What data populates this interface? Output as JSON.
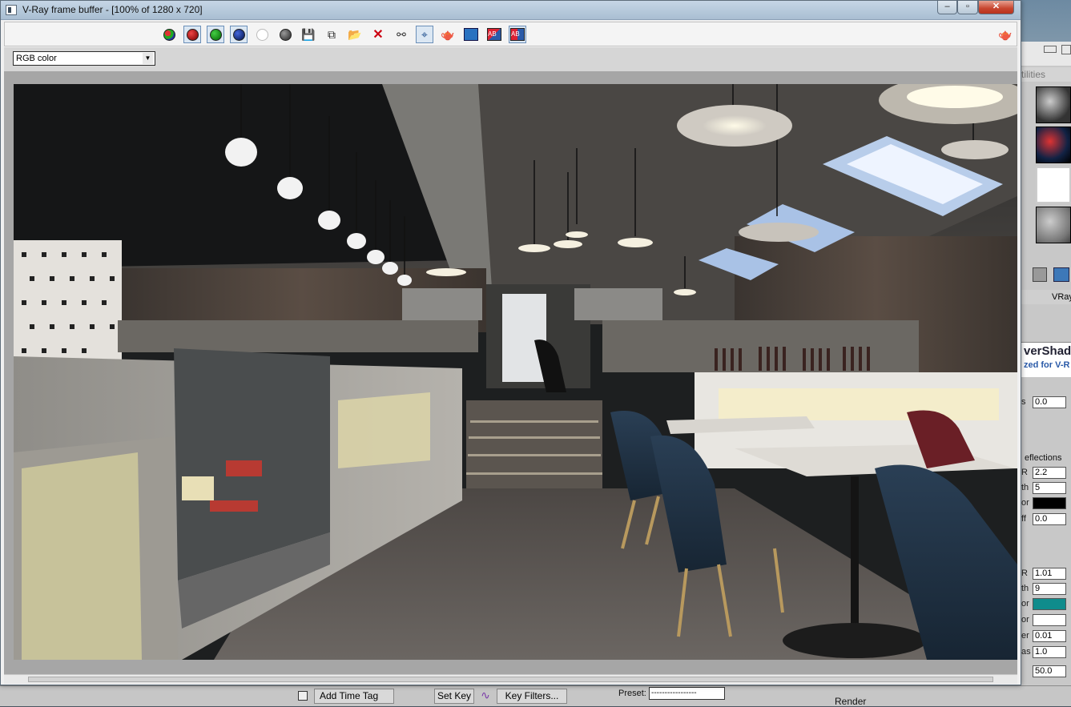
{
  "window": {
    "title": "V-Ray frame buffer - [100% of 1280 x 720]",
    "minimize": "‒",
    "maximize": "▫",
    "close": "✕"
  },
  "toolbar": {
    "channel_buttons": [
      {
        "name": "rgb-channel-icon",
        "color": "#3c6a3c"
      },
      {
        "name": "red-channel-icon",
        "color": "#b41414"
      },
      {
        "name": "green-channel-icon",
        "color": "#1e8c1e"
      },
      {
        "name": "blue-channel-icon",
        "color": "#1e2896"
      },
      {
        "name": "alpha-channel-icon",
        "color": "#ffffff"
      },
      {
        "name": "mono-channel-icon",
        "color": "#555555"
      }
    ],
    "channel": "RGB color"
  },
  "right_panel": {
    "tab": "tilities",
    "vray_label": "VRay",
    "banner_line1": "verShad",
    "banner_line2": "zed for V-R",
    "reflections": "eflections",
    "fields": [
      {
        "label": "s",
        "value": "0.0"
      },
      {
        "label": "R",
        "value": "2.2"
      },
      {
        "label": "th",
        "value": "5"
      },
      {
        "label": "or",
        "value": ""
      },
      {
        "label": "ff",
        "value": "0.0"
      },
      {
        "label": "R",
        "value": "1.01"
      },
      {
        "label": "th",
        "value": "9"
      },
      {
        "label": "or",
        "value": ""
      },
      {
        "label": "or",
        "value": ""
      },
      {
        "label": "er",
        "value": "0.01"
      },
      {
        "label": "as",
        "value": "1.0"
      },
      {
        "label": "",
        "value": "50.0"
      }
    ]
  },
  "bottom_bar": {
    "add_time_tag": "Add Time Tag",
    "set_key": "Set Key",
    "key_filters": "Key Filters...",
    "preset_label": "Preset:",
    "preset_value": "-----------------",
    "render": "Render"
  }
}
